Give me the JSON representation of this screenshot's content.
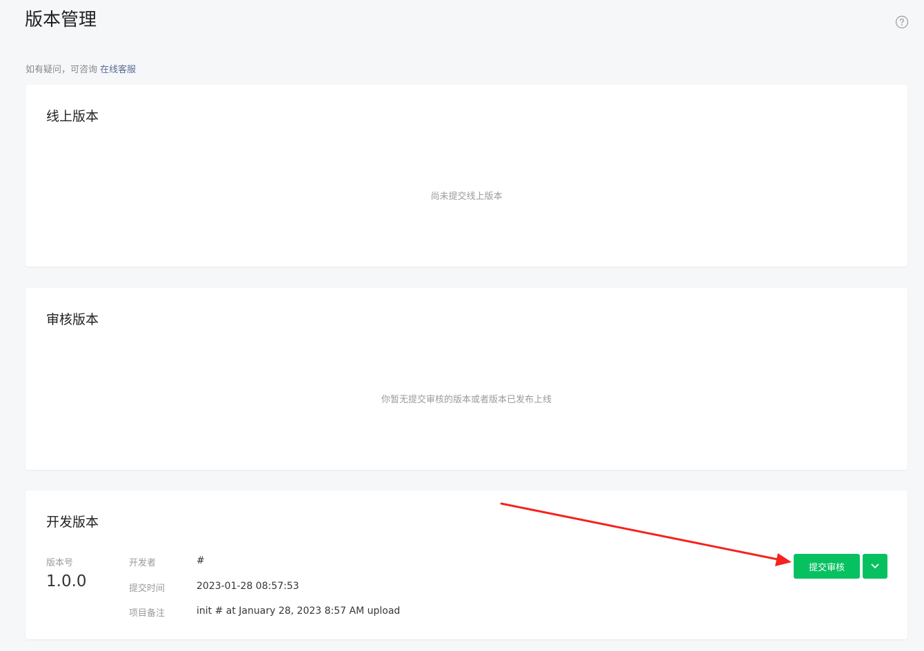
{
  "header": {
    "title": "版本管理",
    "help_icon": "question-circle-icon"
  },
  "notice": {
    "text": "如有疑问，可咨询 ",
    "link": "在线客服"
  },
  "online": {
    "title": "线上版本",
    "empty": "尚未提交线上版本"
  },
  "review": {
    "title": "审核版本",
    "empty": "你暂无提交审核的版本或者版本已发布上线"
  },
  "dev": {
    "title": "开发版本",
    "version_label": "版本号",
    "version": "1.0.0",
    "developer_label": "开发者",
    "developer": "#",
    "time_label": "提交时间",
    "time": "2023-01-28 08:57:53",
    "note_label": "项目备注",
    "note": "init # at January 28, 2023 8:57 AM upload",
    "submit_label": "提交审核",
    "more_icon": "chevron-down-icon"
  },
  "colors": {
    "accent": "#07c160",
    "link": "#576b95",
    "annotation_arrow": "#f5221e"
  }
}
